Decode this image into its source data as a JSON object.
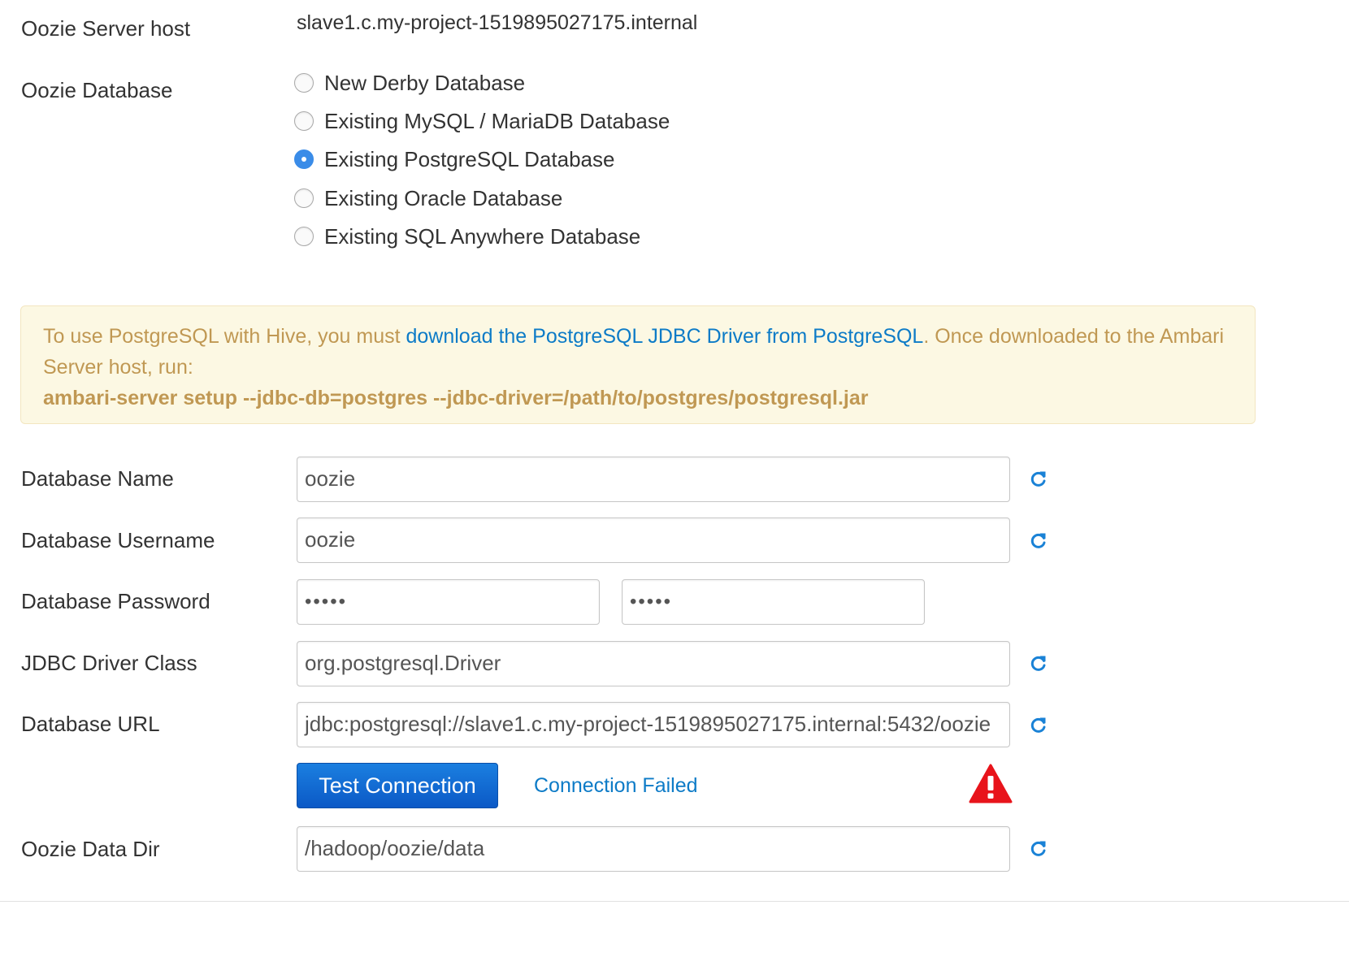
{
  "server": {
    "label": "Oozie Server host",
    "value": "slave1.c.my-project-1519895027175.internal"
  },
  "database": {
    "label": "Oozie Database",
    "options": [
      {
        "label": "New Derby Database",
        "checked": false
      },
      {
        "label": "Existing MySQL / MariaDB Database",
        "checked": false
      },
      {
        "label": "Existing PostgreSQL Database",
        "checked": true
      },
      {
        "label": "Existing Oracle Database",
        "checked": false
      },
      {
        "label": "Existing SQL Anywhere Database",
        "checked": false
      }
    ]
  },
  "alert": {
    "text_before": "To use PostgreSQL with Hive, you must ",
    "link_text": "download the PostgreSQL JDBC Driver from PostgreSQL",
    "text_after": ". Once downloaded to the Ambari Server host, run:",
    "command": "ambari-server setup --jdbc-db=postgres --jdbc-driver=/path/to/postgres/postgresql.jar"
  },
  "fields": {
    "db_name": {
      "label": "Database Name",
      "value": "oozie"
    },
    "db_username": {
      "label": "Database Username",
      "value": "oozie"
    },
    "db_password": {
      "label": "Database Password",
      "value": "•••••",
      "confirm_value": "•••••"
    },
    "jdbc_driver_class": {
      "label": "JDBC Driver Class",
      "value": "org.postgresql.Driver"
    },
    "db_url": {
      "label": "Database URL",
      "value": "jdbc:postgresql://slave1.c.my-project-1519895027175.internal:5432/oozie"
    },
    "data_dir": {
      "label": "Oozie Data Dir",
      "value": "/hadoop/oozie/data"
    }
  },
  "test": {
    "button_label": "Test Connection",
    "status_text": "Connection Failed"
  },
  "icons": {
    "undo": "refresh-icon",
    "warning": "warning-triangle-icon"
  },
  "colors": {
    "accent": "#3a8ce8",
    "link": "#0d7bc7",
    "button": "#0b59c6",
    "alert_bg": "#fcf8e3",
    "alert_text": "#c09853",
    "warning": "#e8141b"
  }
}
